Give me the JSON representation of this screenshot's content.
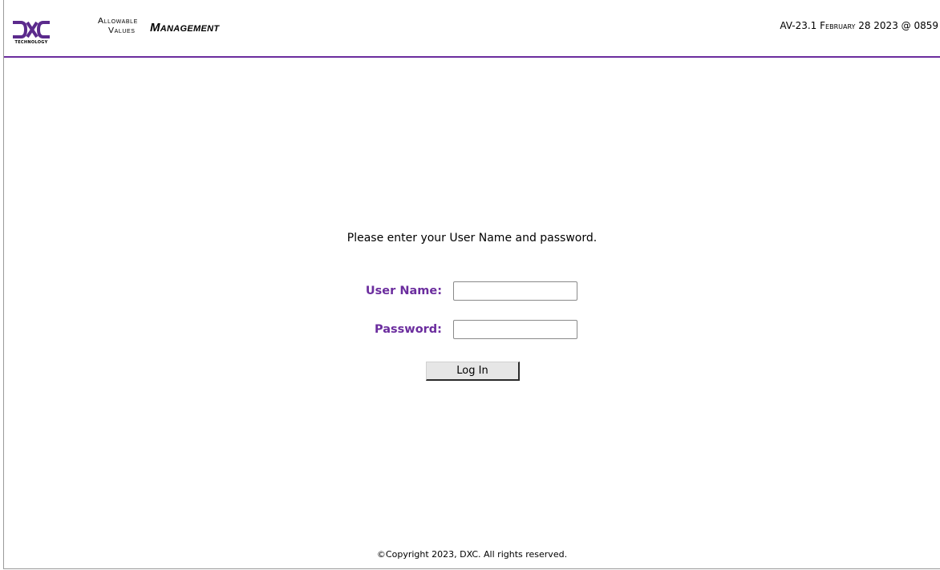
{
  "header": {
    "logo_alt": "DXC",
    "logo_subtext": "TECHNOLOGY",
    "title_line1": "Allowable",
    "title_line2": "Values",
    "title_main": "Management",
    "version": "AV-23.1 February 28 2023 @ 0859"
  },
  "login": {
    "prompt": "Please enter your User Name and password.",
    "username_label": "User Name:",
    "username_value": "",
    "password_label": "Password:",
    "password_value": "",
    "submit_label": "Log In"
  },
  "footer": {
    "copyright": "©Copyright 2023, DXC. All rights reserved."
  },
  "colors": {
    "accent": "#6b2d9e",
    "header_rule": "#6b2d9e"
  }
}
